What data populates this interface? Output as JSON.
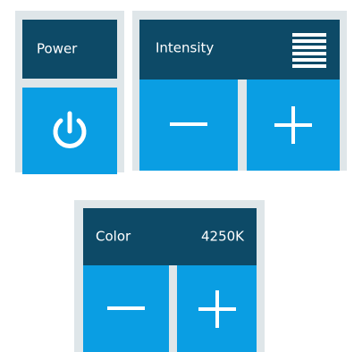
{
  "power": {
    "label": "Power",
    "icon": "power-icon"
  },
  "intensity": {
    "label": "Intensity",
    "level_icon": "intensity-level-icon",
    "decrease_icon": "minus-icon",
    "increase_icon": "plus-icon"
  },
  "color": {
    "label": "Color",
    "value": "4250K",
    "decrease_icon": "minus-icon",
    "increase_icon": "plus-icon"
  },
  "colors": {
    "header": "#0d4a67",
    "button": "#0a9ee3",
    "card_bg": "#dfe6e9",
    "text": "#ffffff"
  }
}
